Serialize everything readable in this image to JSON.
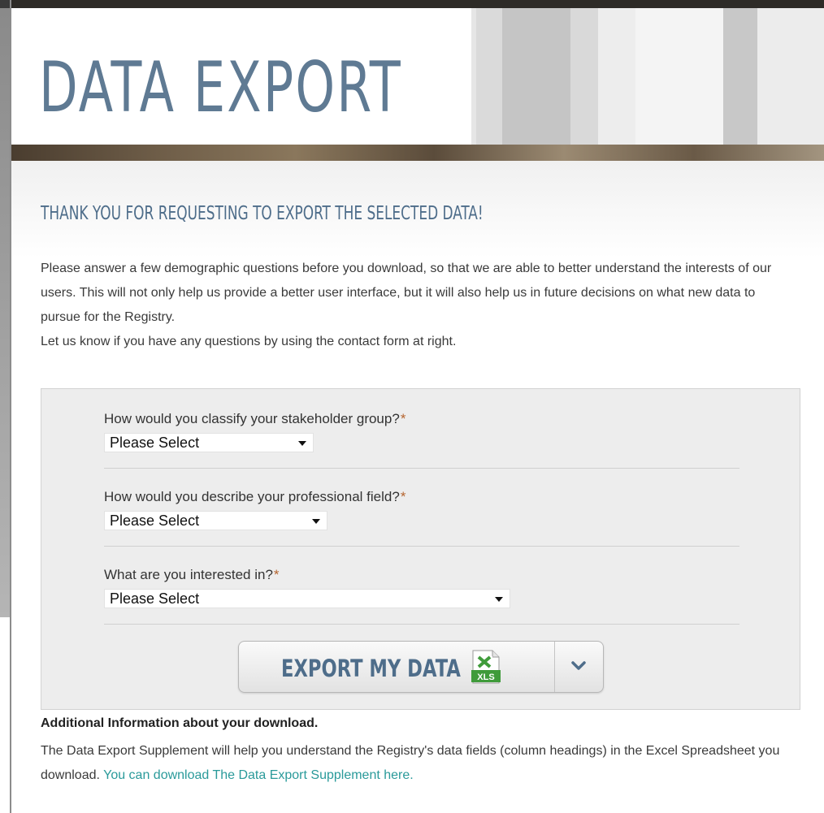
{
  "banner": {
    "title": "DATA EXPORT"
  },
  "main": {
    "heading": "THANK YOU FOR REQUESTING TO EXPORT THE SELECTED DATA!",
    "intro": [
      "Please answer a few demographic questions before you download, so that we are able to better understand the interests of our users. This will not only help us provide a better user interface, but it will also help us in future decisions on what new data to pursue for the Registry.",
      "Let us know if you have any questions by using the contact form at right."
    ]
  },
  "form": {
    "questions": [
      {
        "label": "How would you classify your stakeholder group?",
        "required": "*",
        "value": "Please Select"
      },
      {
        "label": "How would you describe your professional field?",
        "required": "*",
        "value": "Please Select"
      },
      {
        "label": "What are you interested in?",
        "required": "*",
        "value": "Please Select"
      }
    ],
    "export_button": {
      "label": "EXPORT MY DATA",
      "icon": "excel-xls-icon",
      "toggle_icon": "chevron-down-icon"
    }
  },
  "additional": {
    "title": "Additional Information about your download.",
    "text": "The Data Export Supplement will help you understand the Registry's data fields (column headings) in the Excel Spreadsheet you download.",
    "link": "You can download The Data Export Supplement here."
  },
  "colors": {
    "heading": "#4e6d8a",
    "title": "#5f7a93",
    "link": "#2a9a9a",
    "required": "#b5652f",
    "xls_green": "#3f9b3a"
  }
}
